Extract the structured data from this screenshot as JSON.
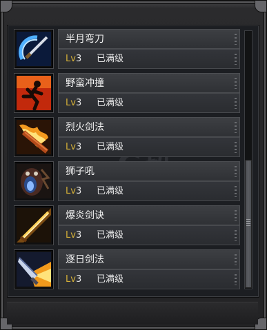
{
  "skills": [
    {
      "name": "半月弯刀",
      "lv_label": "Lv",
      "level": "3",
      "status": "已满级",
      "icon": "crescent-blade-icon"
    },
    {
      "name": "野蛮冲撞",
      "lv_label": "Lv",
      "level": "3",
      "status": "已满级",
      "icon": "charge-runner-icon"
    },
    {
      "name": "烈火剑法",
      "lv_label": "Lv",
      "level": "3",
      "status": "已满级",
      "icon": "flame-sword-icon"
    },
    {
      "name": "狮子吼",
      "lv_label": "Lv",
      "level": "3",
      "status": "已满级",
      "icon": "lion-roar-icon"
    },
    {
      "name": "爆炎剑诀",
      "lv_label": "Lv",
      "level": "3",
      "status": "已满级",
      "icon": "blazing-sword-icon"
    },
    {
      "name": "逐日剑法",
      "lv_label": "Lv",
      "level": "3",
      "status": "已满级",
      "icon": "sun-chasing-sword-icon"
    }
  ],
  "colors": {
    "level_label": "#d7b238",
    "text": "#f2f2f2"
  }
}
